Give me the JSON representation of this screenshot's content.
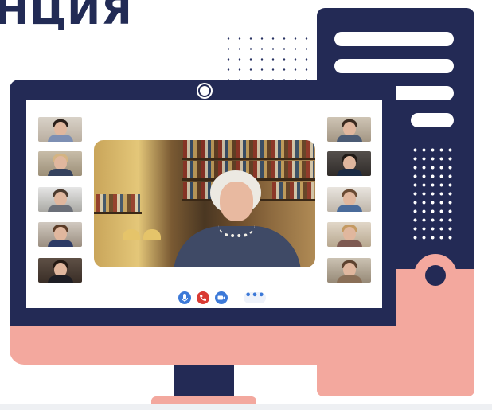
{
  "heading": {
    "text": "НЦИЯ"
  },
  "colors": {
    "navy": "#232a55",
    "salmon": "#f3a89e",
    "mic_blue": "#3c79d8",
    "end_call_red": "#d93a33",
    "video_blue": "#3c79d8"
  },
  "conference": {
    "left_participants": [
      "participant-1",
      "participant-2",
      "participant-3",
      "participant-4",
      "participant-5"
    ],
    "right_participants": [
      "participant-6",
      "participant-7",
      "participant-8",
      "participant-9",
      "participant-10"
    ],
    "controls": {
      "mic_icon": "microphone-icon",
      "end_call_icon": "phone-hangup-icon",
      "video_icon": "video-camera-icon",
      "more_label": "•••"
    }
  }
}
